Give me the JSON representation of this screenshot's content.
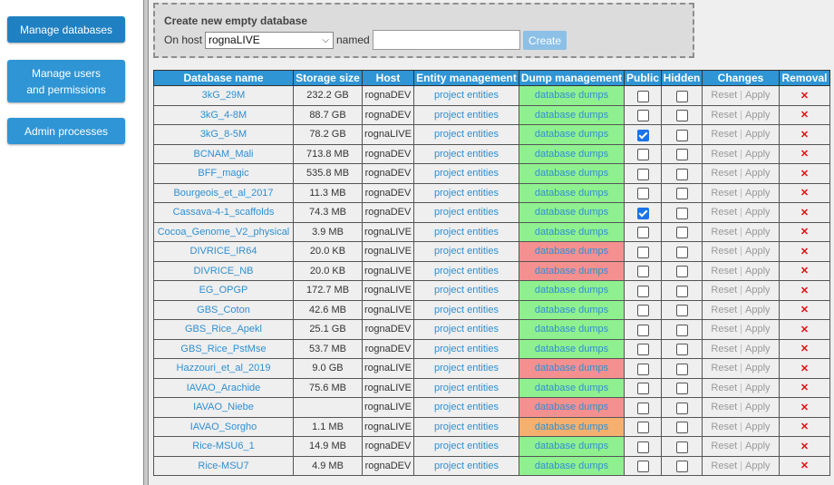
{
  "sidebar": {
    "manage_databases": "Manage databases",
    "manage_users": "Manage users\nand permissions",
    "admin_processes": "Admin processes"
  },
  "create": {
    "title": "Create new empty database",
    "on_host_label": "On host",
    "host_selected": "rognaLIVE",
    "named_label": "named",
    "name_value": "",
    "create_label": "Create"
  },
  "table": {
    "headers": [
      "Database name",
      "Storage size",
      "Host",
      "Entity management",
      "Dump management",
      "Public",
      "Hidden",
      "Changes",
      "Removal"
    ],
    "reset_label": "Reset",
    "apply_label": "Apply",
    "remove_glyph": "✕",
    "rows": [
      {
        "name": "3kG_29M",
        "size": "232.2 GB",
        "host": "rognaDEV",
        "entities": "project entities",
        "dumps": "database dumps",
        "dump_status": "green",
        "public": false,
        "hidden": false
      },
      {
        "name": "3kG_4-8M",
        "size": "88.7 GB",
        "host": "rognaDEV",
        "entities": "project entities",
        "dumps": "database dumps",
        "dump_status": "green",
        "public": false,
        "hidden": false
      },
      {
        "name": "3kG_8-5M",
        "size": "78.2 GB",
        "host": "rognaLIVE",
        "entities": "project entities",
        "dumps": "database dumps",
        "dump_status": "green",
        "public": true,
        "hidden": false
      },
      {
        "name": "BCNAM_Mali",
        "size": "713.8 MB",
        "host": "rognaDEV",
        "entities": "project entities",
        "dumps": "database dumps",
        "dump_status": "green",
        "public": false,
        "hidden": false
      },
      {
        "name": "BFF_magic",
        "size": "535.8 MB",
        "host": "rognaDEV",
        "entities": "project entities",
        "dumps": "database dumps",
        "dump_status": "green",
        "public": false,
        "hidden": false
      },
      {
        "name": "Bourgeois_et_al_2017",
        "size": "11.3 MB",
        "host": "rognaDEV",
        "entities": "project entities",
        "dumps": "database dumps",
        "dump_status": "green",
        "public": false,
        "hidden": false
      },
      {
        "name": "Cassava-4-1_scaffolds",
        "size": "74.3 MB",
        "host": "rognaDEV",
        "entities": "project entities",
        "dumps": "database dumps",
        "dump_status": "green",
        "public": true,
        "hidden": false
      },
      {
        "name": "Cocoa_Genome_V2_physical",
        "size": "3.9 MB",
        "host": "rognaLIVE",
        "entities": "project entities",
        "dumps": "database dumps",
        "dump_status": "green",
        "public": false,
        "hidden": false
      },
      {
        "name": "DIVRICE_IR64",
        "size": "20.0 KB",
        "host": "rognaLIVE",
        "entities": "project entities",
        "dumps": "database dumps",
        "dump_status": "red",
        "public": false,
        "hidden": false
      },
      {
        "name": "DIVRICE_NB",
        "size": "20.0 KB",
        "host": "rognaLIVE",
        "entities": "project entities",
        "dumps": "database dumps",
        "dump_status": "red",
        "public": false,
        "hidden": false
      },
      {
        "name": "EG_OPGP",
        "size": "172.7 MB",
        "host": "rognaLIVE",
        "entities": "project entities",
        "dumps": "database dumps",
        "dump_status": "green",
        "public": false,
        "hidden": false
      },
      {
        "name": "GBS_Coton",
        "size": "42.6 MB",
        "host": "rognaLIVE",
        "entities": "project entities",
        "dumps": "database dumps",
        "dump_status": "green",
        "public": false,
        "hidden": false
      },
      {
        "name": "GBS_Rice_Apekl",
        "size": "25.1 GB",
        "host": "rognaDEV",
        "entities": "project entities",
        "dumps": "database dumps",
        "dump_status": "green",
        "public": false,
        "hidden": false
      },
      {
        "name": "GBS_Rice_PstMse",
        "size": "53.7 MB",
        "host": "rognaDEV",
        "entities": "project entities",
        "dumps": "database dumps",
        "dump_status": "green",
        "public": false,
        "hidden": false
      },
      {
        "name": "Hazzouri_et_al_2019",
        "size": "9.0 GB",
        "host": "rognaLIVE",
        "entities": "project entities",
        "dumps": "database dumps",
        "dump_status": "red",
        "public": false,
        "hidden": false
      },
      {
        "name": "IAVAO_Arachide",
        "size": "75.6 MB",
        "host": "rognaLIVE",
        "entities": "project entities",
        "dumps": "database dumps",
        "dump_status": "green",
        "public": false,
        "hidden": false
      },
      {
        "name": "IAVAO_Niebe",
        "size": "",
        "host": "rognaLIVE",
        "entities": "project entities",
        "dumps": "database dumps",
        "dump_status": "red",
        "public": false,
        "hidden": false
      },
      {
        "name": "IAVAO_Sorgho",
        "size": "1.1 MB",
        "host": "rognaLIVE",
        "entities": "project entities",
        "dumps": "database dumps",
        "dump_status": "orange",
        "public": false,
        "hidden": false
      },
      {
        "name": "Rice-MSU6_1",
        "size": "14.9 MB",
        "host": "rognaDEV",
        "entities": "project entities",
        "dumps": "database dumps",
        "dump_status": "green",
        "public": false,
        "hidden": false
      },
      {
        "name": "Rice-MSU7",
        "size": "4.9 MB",
        "host": "rognaDEV",
        "entities": "project entities",
        "dumps": "database dumps",
        "dump_status": "green",
        "public": false,
        "hidden": false
      }
    ]
  }
}
